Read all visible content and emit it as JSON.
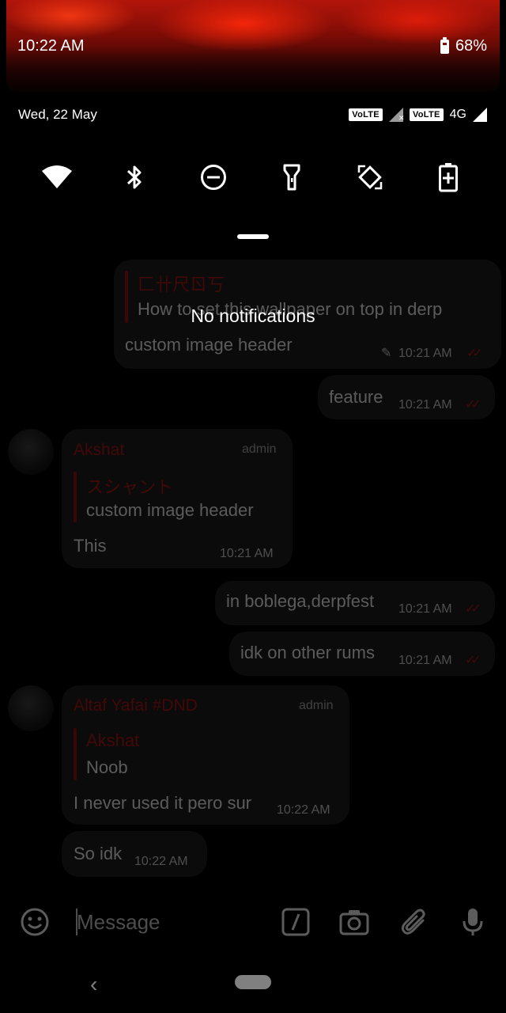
{
  "status_bar": {
    "time": "10:22 AM",
    "battery": "68%",
    "date": "Wed, 22 May",
    "volte_1": "VoLTE",
    "volte_2": "VoLTE",
    "network": "4G"
  },
  "quick_settings": {
    "tiles": [
      "wifi-icon",
      "bluetooth-icon",
      "do-not-disturb-icon",
      "flashlight-icon",
      "auto-rotate-icon",
      "battery-saver-icon"
    ]
  },
  "shade": {
    "empty_text": "No notifications"
  },
  "chat": {
    "messages": [
      {
        "reply_name": "匚卄尺ㄖ丂",
        "reply_text": "How to set this wallpaper on top in derp",
        "text": "custom image header",
        "time": "10:21 AM",
        "outgoing": true,
        "edited": true
      },
      {
        "text": "feature",
        "time": "10:21 AM",
        "outgoing": true
      },
      {
        "sender": "Akshat",
        "role": "admin",
        "reply_name": "スシャント",
        "reply_text": "custom image header",
        "text": "This",
        "time": "10:21 AM",
        "outgoing": false
      },
      {
        "text": "in boblega,derpfest",
        "time": "10:21 AM",
        "outgoing": true
      },
      {
        "text": "idk on other rums",
        "time": "10:21 AM",
        "outgoing": true
      },
      {
        "sender": "Altaf Yafai #DND",
        "role": "admin",
        "reply_name": "Akshat",
        "reply_text": "Noob",
        "text": "I never used it pero sur",
        "time": "10:22 AM",
        "outgoing": false
      },
      {
        "text": "So idk",
        "time": "10:22 AM",
        "outgoing": false
      }
    ],
    "input_placeholder": "Message"
  },
  "colors": {
    "accent": "#a01414",
    "bubble": "#1b1b1b",
    "background": "#000000"
  }
}
